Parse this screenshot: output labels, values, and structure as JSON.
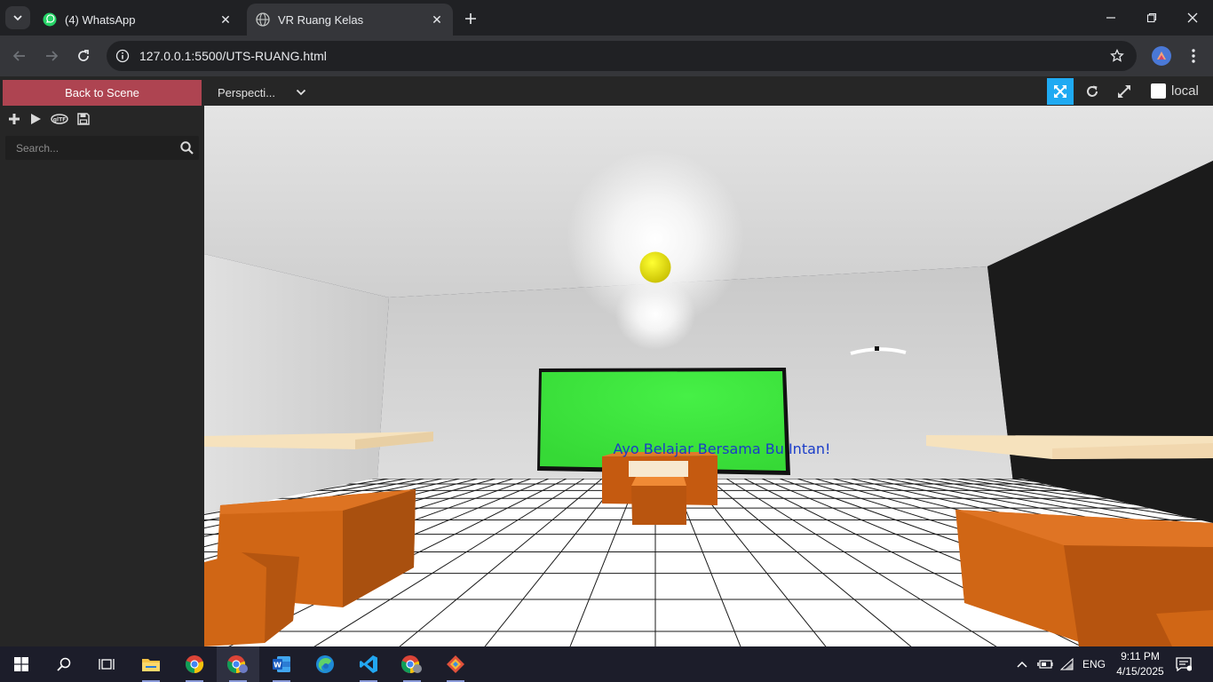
{
  "browser": {
    "tabs": [
      {
        "title": "(4) WhatsApp",
        "favicon": "whatsapp-icon",
        "active": false
      },
      {
        "title": "VR Ruang Kelas",
        "favicon": "globe-icon",
        "active": true
      }
    ],
    "url_host": "127.0.0.1",
    "url_rest": ":5500/UTS-RUANG.html"
  },
  "inspector": {
    "back_label": "Back to Scene",
    "search_placeholder": "Search...",
    "camera_label": "Perspecti...",
    "local_label": "local"
  },
  "scene": {
    "board_text": "Ayo Belajar Bersama Bu Intan!",
    "board_color": "#3ee83e",
    "sphere_color": "#e6e000",
    "desk_color": "#d5671c"
  },
  "taskbar": {
    "language": "ENG",
    "time": "9:11 PM",
    "date": "4/15/2025"
  },
  "colors": {
    "back_button": "#ae4451",
    "active_tool": "#1faaf2"
  }
}
